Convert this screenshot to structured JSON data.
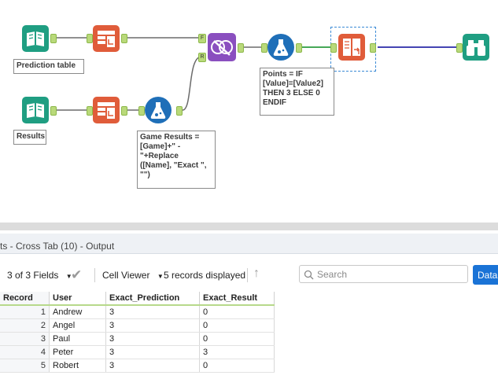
{
  "canvas": {
    "annotations": {
      "prediction_table": "Prediction table",
      "results": "Results",
      "game_results": "Game Results =\n[Game]+\" -\n\"+Replace\n([Name], \"Exact \",\n\"\")",
      "points": "Points = IF\n[Value]=[Value2]\nTHEN 3 ELSE 0\nENDIF"
    },
    "join_anchor_left_top": "F",
    "join_anchor_left_bottom": "R",
    "colors": {
      "input_tool": "#1f9e82",
      "transform_tool": "#e05c3a",
      "formula_tool": "#1f6fb8",
      "join_tool": "#8a4fbf",
      "browse_tool": "#1f9e82",
      "connection": "#6b6b6b",
      "selected_connection_green": "#2c9c3f",
      "selected_connection_blue": "#2a2aa8"
    }
  },
  "results": {
    "title": "ts - Cross Tab (10) - Output",
    "toolbar": {
      "fields_selector": "3 of 3 Fields",
      "cell_viewer": "Cell Viewer",
      "records_displayed": "5 records displayed",
      "search_placeholder": "Search",
      "data_button": "Data"
    },
    "table": {
      "headers": [
        "Record",
        "User",
        "Exact_Prediction",
        "Exact_Result"
      ],
      "rows": [
        [
          "1",
          "Andrew",
          "3",
          "0"
        ],
        [
          "2",
          "Angel",
          "3",
          "0"
        ],
        [
          "3",
          "Paul",
          "3",
          "0"
        ],
        [
          "4",
          "Peter",
          "3",
          "3"
        ],
        [
          "5",
          "Robert",
          "3",
          "0"
        ]
      ]
    }
  }
}
